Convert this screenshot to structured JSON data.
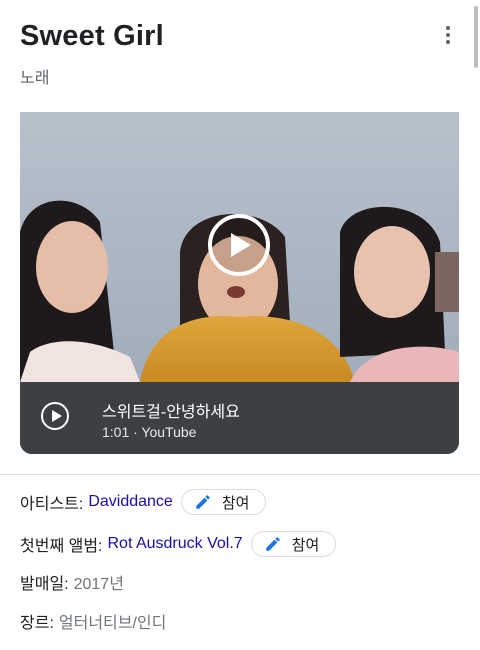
{
  "header": {
    "title": "Sweet Girl",
    "subtitle": "노래"
  },
  "video": {
    "title": "스위트걸-안녕하세요",
    "meta": "1:01 · YouTube"
  },
  "details": {
    "artist_label": "아티스트:",
    "artist_value": "Daviddance",
    "album_label": "첫번째 앨범:",
    "album_value": "Rot Ausdruck Vol.7",
    "contribute_label": "참여",
    "release_label": "발매일:",
    "release_value": "2017년",
    "genre_label": "장르:",
    "genre_value": "얼터너티브/인디"
  },
  "colors": {
    "link": "#1a0dab",
    "info_bar": "#3c4043",
    "edit_icon": "#1a73e8"
  },
  "icons": [
    "more-vert-icon",
    "play-icon",
    "play-circle-icon",
    "edit-pencil-icon"
  ]
}
